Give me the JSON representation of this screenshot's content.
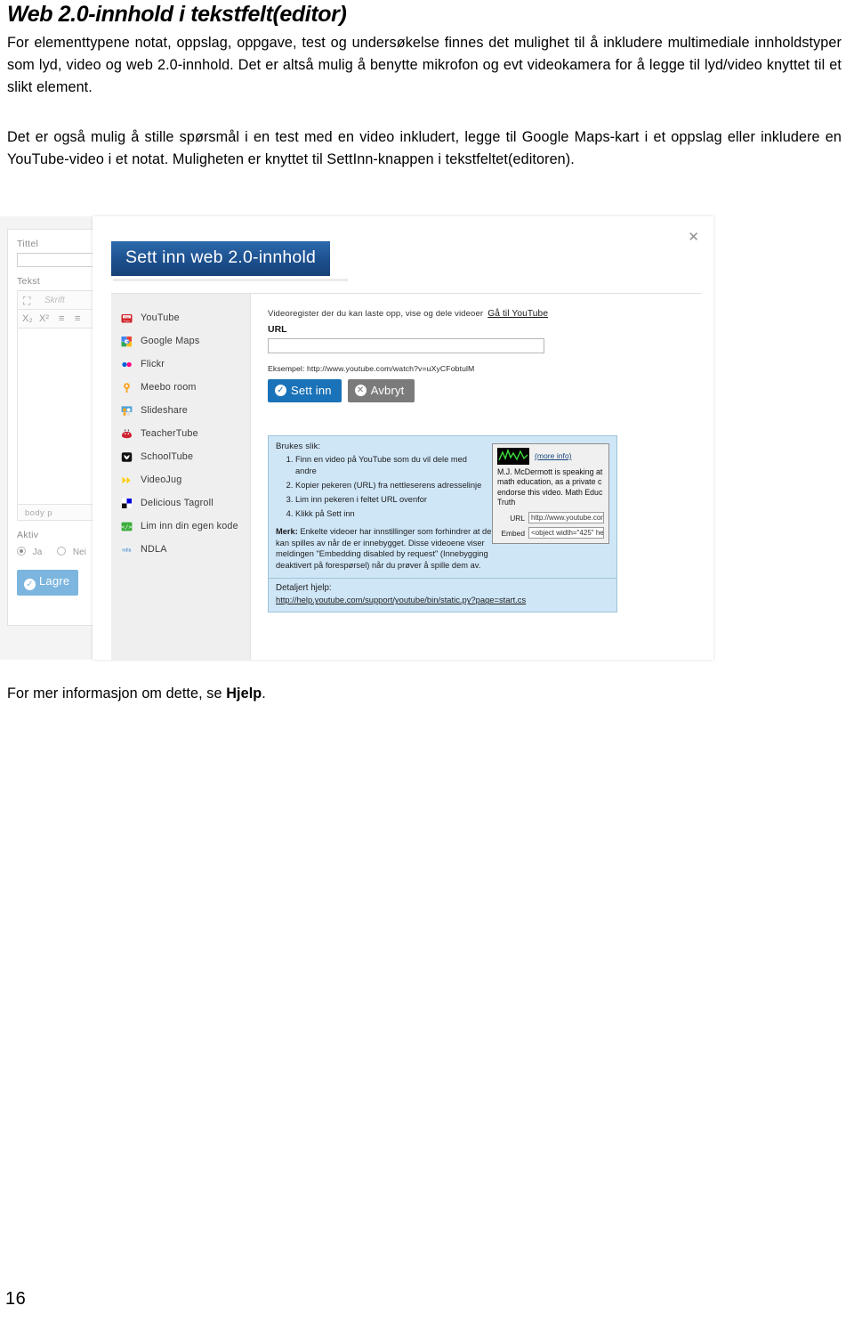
{
  "document": {
    "title": "Web 2.0-innhold i tekstfelt(editor)",
    "paragraph1": "For elementtypene notat, oppslag, oppgave, test og undersøkelse finnes det mulighet til å inkludere multimediale innholdstyper som lyd, video og web 2.0-innhold. Det er altså mulig å benytte mikrofon og evt videokamera for å legge til lyd/video knyttet til et slikt element.",
    "paragraph2": "Det er også mulig å stille spørsmål i en test med en video inkludert, legge til Google Maps-kart i et oppslag eller inkludere en YouTube-video i et notat. Muligheten er knyttet til SettInn-knappen i tekstfeltet(editoren).",
    "closing_prefix": "For mer informasjon om dette, se ",
    "closing_link": "Hjelp",
    "closing_suffix": ".",
    "page_number": "16"
  },
  "background_form": {
    "title_label": "Tittel",
    "title_value": "",
    "text_label": "Tekst",
    "toolbar": {
      "fullscreen_icon": "fullscreen-icon",
      "font_label": "Skrift",
      "subscript_label": "X₂",
      "superscript_label": "X²",
      "indent_icon": "indent-icon",
      "list_icon": "list-icon"
    },
    "status_path": "body  p",
    "active_label": "Aktiv",
    "active_yes": "Ja",
    "active_no": "Nei",
    "active_selected": "Ja",
    "save_label": "Lagre"
  },
  "dialog": {
    "title": "Sett inn web 2.0-innhold",
    "close_icon": "close-icon",
    "providers": [
      {
        "label": "YouTube",
        "icon": "youtube-icon",
        "selected": true
      },
      {
        "label": "Google Maps",
        "icon": "google-maps-icon",
        "selected": false
      },
      {
        "label": "Flickr",
        "icon": "flickr-icon",
        "selected": false
      },
      {
        "label": "Meebo room",
        "icon": "meebo-icon",
        "selected": false
      },
      {
        "label": "Slideshare",
        "icon": "slideshare-icon",
        "selected": false
      },
      {
        "label": "TeacherTube",
        "icon": "teachertube-icon",
        "selected": false
      },
      {
        "label": "SchoolTube",
        "icon": "schooltube-icon",
        "selected": false
      },
      {
        "label": "VideoJug",
        "icon": "videojug-icon",
        "selected": false
      },
      {
        "label": "Delicious Tagroll",
        "icon": "delicious-icon",
        "selected": false
      },
      {
        "label": "Lim inn din egen kode",
        "icon": "code-icon",
        "selected": false
      },
      {
        "label": "NDLA",
        "icon": "ndla-icon",
        "selected": false
      }
    ],
    "description": "Videoregister der du kan laste opp, vise og dele videoer",
    "description_link": "Gå til YouTube",
    "url_label": "URL",
    "url_value": "",
    "example": "Eksempel: http://www.youtube.com/watch?v=uXyCFobtulM",
    "insert_button": "Sett inn",
    "cancel_button": "Avbryt",
    "help": {
      "heading": "Brukes slik:",
      "steps": [
        "Finn en video på YouTube som du vil dele med andre",
        "Kopier pekeren (URL) fra nettleserens adresselinje",
        "Lim inn pekeren i feltet URL ovenfor",
        "Klikk på Sett inn"
      ],
      "note_label": "Merk:",
      "note_text": " Enkelte videoer har innstillinger som forhindrer at de kan spilles av når de er innebygget. Disse videoene viser meldingen \"Embedding disabled by request\" (Innebygging deaktivert på forespørsel) når du prøver å spille dem av.",
      "detail_label": "Detaljert hjelp:",
      "detail_link": "http://help.youtube.com/support/youtube/bin/static.py?page=start.cs"
    },
    "preview": {
      "more_info": "(more info)",
      "description": "M.J. McDermott is speaking at math education, as a private c endorse this video. Math Educ Truth",
      "url_label": "URL",
      "url_value": "http://www.youtube.con",
      "embed_label": "Embed",
      "embed_value": "<object width=\"425\" he"
    }
  },
  "colors": {
    "dialog_title_blue": "#1c4f8d",
    "primary_button": "#1a72b8",
    "secondary_button": "#7b7b7b",
    "help_box": "#cfe6f7",
    "help_border": "#9dc3d8",
    "save_button": "#7cb6df"
  }
}
